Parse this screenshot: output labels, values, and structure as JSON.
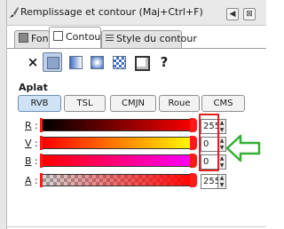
{
  "window": {
    "title": "Remplissage et contour (Maj+Ctrl+F)"
  },
  "tabs": [
    {
      "label": "Fond",
      "active": false
    },
    {
      "label": "Contour",
      "active": true
    },
    {
      "label": "Style du contour",
      "active": false
    }
  ],
  "paint_modes": {
    "none_glyph": "×",
    "unset_glyph": "?",
    "selected": "flat-color"
  },
  "section_label": "Aplat",
  "color_models": [
    "RVB",
    "TSL",
    "CMJN",
    "Roue",
    "CMS"
  ],
  "selected_model": "RVB",
  "channels": [
    {
      "label": "R",
      "suffix": " :",
      "value": "255"
    },
    {
      "label": "V",
      "suffix": " :",
      "value": "0"
    },
    {
      "label": "B",
      "suffix": " :",
      "value": "0"
    },
    {
      "label": "A",
      "suffix": " :",
      "value": "255"
    }
  ],
  "colors": {
    "highlight": "#e02020",
    "arrow": "#33b033",
    "selected_button": "#cfe3f7",
    "current_color": "#ff0000"
  }
}
